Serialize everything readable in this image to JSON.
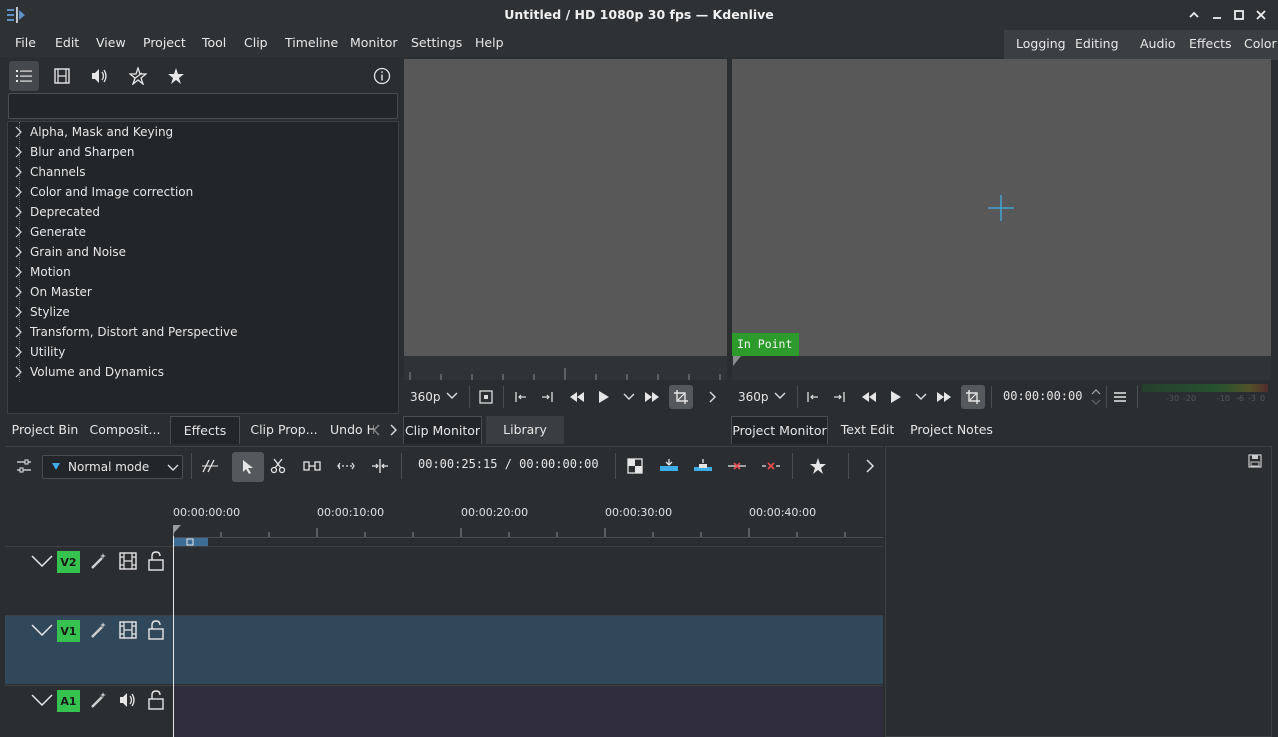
{
  "window": {
    "title": "Untitled / HD 1080p 30 fps — Kdenlive"
  },
  "menu": [
    "File",
    "Edit",
    "View",
    "Project",
    "Tool",
    "Clip",
    "Timeline",
    "Monitor",
    "Settings",
    "Help"
  ],
  "layouts": [
    "Logging",
    "Editing",
    "Audio",
    "Effects",
    "Color"
  ],
  "effects": {
    "search_placeholder": "",
    "categories": [
      "Alpha, Mask and Keying",
      "Blur and Sharpen",
      "Channels",
      "Color and Image correction",
      "Deprecated",
      "Generate",
      "Grain and Noise",
      "Motion",
      "On Master",
      "Stylize",
      "Transform, Distort and Perspective",
      "Utility",
      "Volume and Dynamics"
    ]
  },
  "dock_tabs_left": [
    "Project Bin",
    "Composit...",
    "Effects",
    "Clip Prop...",
    "Undo H"
  ],
  "dock_tabs_middle": [
    "Clip Monitor",
    "Library"
  ],
  "dock_tabs_right": [
    "Project Monitor",
    "Text Edit",
    "Project Notes"
  ],
  "clip_monitor": {
    "resolution": "360p"
  },
  "project_monitor": {
    "resolution": "360p",
    "timecode": "00:00:00:00",
    "in_point_label": "In Point"
  },
  "audio_meter_labels": [
    "-30",
    "-20",
    "-10",
    "-6",
    "-3",
    "0"
  ],
  "timeline": {
    "mode": "Normal mode",
    "timecode": "00:00:25:15 / 00:00:00:00",
    "ruler_labels": [
      "00:00:00:00",
      "00:00:10:00",
      "00:00:20:00",
      "00:00:30:00",
      "00:00:40:00"
    ],
    "tracks": [
      {
        "name": "V2",
        "type": "video"
      },
      {
        "name": "V1",
        "type": "video"
      },
      {
        "name": "A1",
        "type": "audio"
      }
    ]
  },
  "colors": {
    "accent": "#3daee9",
    "track_badge": "#35c24e",
    "in_point": "#2c9b2c",
    "selected_track": "#31475a",
    "audio_track": "#302d3c"
  }
}
